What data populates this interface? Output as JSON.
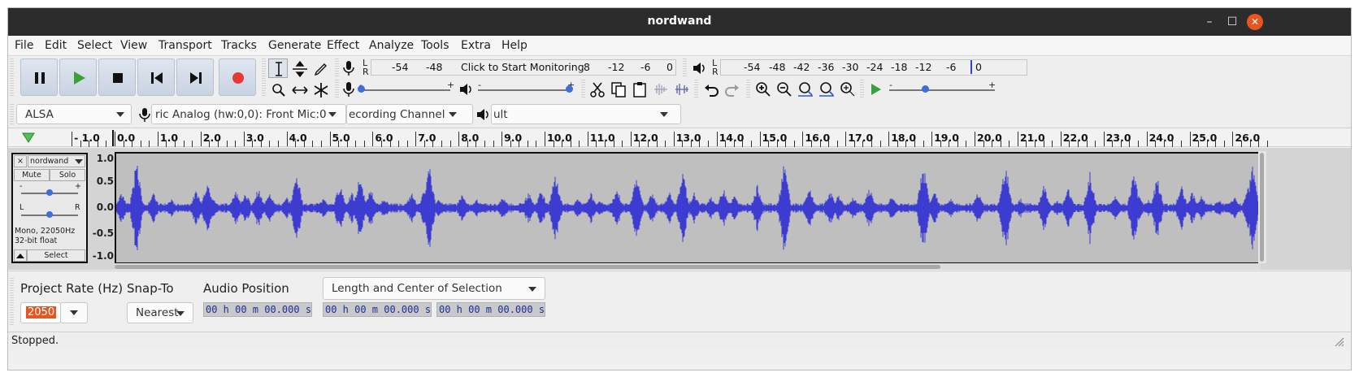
{
  "window": {
    "title": "nordwand",
    "minimize_glyph": "–",
    "maximize_glyph": "☐",
    "close_glyph": "✕"
  },
  "menu": [
    "File",
    "Edit",
    "Select",
    "View",
    "Transport",
    "Tracks",
    "Generate",
    "Effect",
    "Analyze",
    "Tools",
    "Extra",
    "Help"
  ],
  "transport": {
    "buttons": [
      "pause-icon",
      "play-icon",
      "stop-icon",
      "skip-to-start-icon",
      "skip-to-end-icon",
      "record-icon"
    ],
    "record_color": "#e53935",
    "play_color": "#3aa13a"
  },
  "meters": {
    "record_scale": [
      "-54",
      "-48",
      "Click to Start Monitoring",
      "8",
      "-12",
      "-6",
      "0"
    ],
    "play_scale": [
      "-54",
      "-48",
      "-42",
      "-36",
      "-30",
      "-24",
      "-18",
      "-12",
      "-6",
      "0"
    ],
    "lr": [
      "L",
      "R"
    ]
  },
  "mixer": {
    "minus": "-",
    "plus": "+"
  },
  "device": {
    "host": "ALSA",
    "input": "ric Analog (hw:0,0): Front Mic:0",
    "channels": "ecording Channel",
    "output": "ult"
  },
  "ruler": {
    "labels": [
      "- 1.0",
      "0.0",
      "1.0",
      "2.0",
      "3.0",
      "4.0",
      "5.0",
      "6.0",
      "7.0",
      "8.0",
      "9.0",
      "10.0",
      "11.0",
      "12.0",
      "13.0",
      "14.0",
      "15.0",
      "16.0",
      "17.0",
      "18.0",
      "19.0",
      "20.0",
      "21.0",
      "22.0",
      "23.0",
      "24.0",
      "25.0",
      "26.0"
    ]
  },
  "track": {
    "name": "nordwand",
    "close": "×",
    "mute": "Mute",
    "solo": "Solo",
    "gain_minus": "-",
    "gain_plus": "+",
    "pan_left": "L",
    "pan_right": "R",
    "info_line1": "Mono, 22050Hz",
    "info_line2": "32-bit float",
    "select": "Select",
    "scale": [
      "1.0",
      "0.5",
      "0.0",
      "-0.5",
      "-1.0"
    ],
    "wave_color": "#3c3cd0",
    "wave_bg": "#bfbfbf"
  },
  "selection_bar": {
    "project_rate_label": "Project Rate (Hz)",
    "project_rate_value": "2050",
    "snap_to_label": "Snap-To",
    "snap_to_value": "Nearest",
    "audio_position_label": "Audio Position",
    "audio_position_value": "00 h 00 m 00.000 s",
    "selection_mode": "Length and Center of Selection",
    "selection_start": "00 h 00 m 00.000 s",
    "selection_end": "00 h 00 m 00.000 s"
  },
  "status": "Stopped."
}
